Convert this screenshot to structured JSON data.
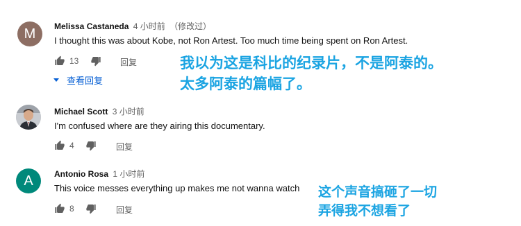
{
  "comments": [
    {
      "author": "Melissa Castaneda",
      "time": "4 小时前",
      "edited": "（修改过）",
      "avatar_letter": "M",
      "avatar_color": "#8d6e63",
      "text": "I thought this was about Kobe, not Ron Artest.  Too much time being spent on Ron Artest.",
      "likes": "13",
      "reply_label": "回复",
      "view_replies_label": "查看回复"
    },
    {
      "author": "Michael Scott",
      "time": "3 小时前",
      "avatar_color": "#6b6f76",
      "text": "I'm confused where are they airing this documentary.",
      "likes": "4",
      "reply_label": "回复"
    },
    {
      "author": "Antonio Rosa",
      "time": "1 小时前",
      "avatar_letter": "A",
      "avatar_color": "#00897b",
      "text": "This voice messes everything up makes me not wanna watch",
      "likes": "8",
      "reply_label": "回复"
    }
  ],
  "overlays": {
    "caption1_line1": "我以为这是科比的纪录片，不是阿泰的。",
    "caption1_line2": "太多阿泰的篇幅了。",
    "caption2_line1": "这个声音搞砸了一切",
    "caption2_line2": "弄得我不想看了"
  },
  "colors": {
    "link_blue": "#065fd4",
    "caption_blue": "#1ba4e2",
    "meta_gray": "#606060"
  }
}
